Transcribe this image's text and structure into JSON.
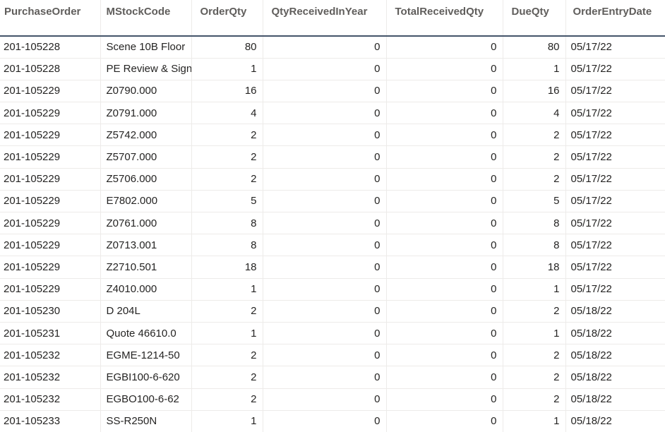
{
  "table": {
    "columns": [
      "PurchaseOrder",
      "MStockCode",
      "OrderQty",
      "QtyReceivedInYear",
      "TotalReceivedQty",
      "DueQty",
      "OrderEntryDate"
    ],
    "rows": [
      [
        "201-105228",
        "Scene 10B Floor",
        "80",
        "0",
        "0",
        "80",
        "05/17/22"
      ],
      [
        "201-105228",
        "PE Review & Sign",
        "1",
        "0",
        "0",
        "1",
        "05/17/22"
      ],
      [
        "201-105229",
        "Z0790.000",
        "16",
        "0",
        "0",
        "16",
        "05/17/22"
      ],
      [
        "201-105229",
        "Z0791.000",
        "4",
        "0",
        "0",
        "4",
        "05/17/22"
      ],
      [
        "201-105229",
        "Z5742.000",
        "2",
        "0",
        "0",
        "2",
        "05/17/22"
      ],
      [
        "201-105229",
        "Z5707.000",
        "2",
        "0",
        "0",
        "2",
        "05/17/22"
      ],
      [
        "201-105229",
        "Z5706.000",
        "2",
        "0",
        "0",
        "2",
        "05/17/22"
      ],
      [
        "201-105229",
        "E7802.000",
        "5",
        "0",
        "0",
        "5",
        "05/17/22"
      ],
      [
        "201-105229",
        "Z0761.000",
        "8",
        "0",
        "0",
        "8",
        "05/17/22"
      ],
      [
        "201-105229",
        "Z0713.001",
        "8",
        "0",
        "0",
        "8",
        "05/17/22"
      ],
      [
        "201-105229",
        "Z2710.501",
        "18",
        "0",
        "0",
        "18",
        "05/17/22"
      ],
      [
        "201-105229",
        "Z4010.000",
        "1",
        "0",
        "0",
        "1",
        "05/17/22"
      ],
      [
        "201-105230",
        "D 204L",
        "2",
        "0",
        "0",
        "2",
        "05/18/22"
      ],
      [
        "201-105231",
        "Quote 46610.0",
        "1",
        "0",
        "0",
        "1",
        "05/18/22"
      ],
      [
        "201-105232",
        "EGME-1214-50",
        "2",
        "0",
        "0",
        "2",
        "05/18/22"
      ],
      [
        "201-105232",
        "EGBI100-6-620",
        "2",
        "0",
        "0",
        "2",
        "05/18/22"
      ],
      [
        "201-105232",
        "EGBO100-6-62",
        "2",
        "0",
        "0",
        "2",
        "05/18/22"
      ],
      [
        "201-105233",
        "SS-R250N",
        "1",
        "0",
        "0",
        "1",
        "05/18/22"
      ]
    ]
  },
  "colors": {
    "header_text": "#605e5c",
    "header_underline": "#44546a",
    "cell_text": "#252423",
    "grid_lines": "#edebe9"
  }
}
